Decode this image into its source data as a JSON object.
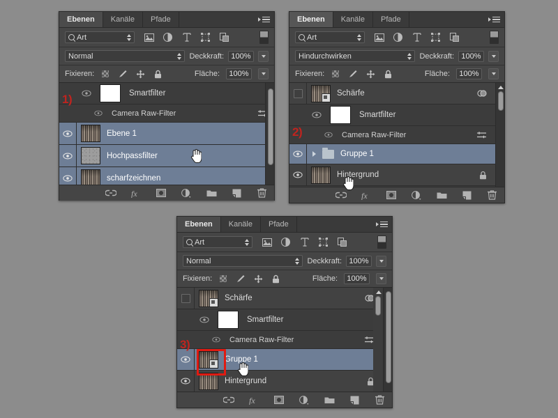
{
  "app": {
    "tabs": [
      "Ebenen",
      "Kanäle",
      "Pfade"
    ],
    "kind_filter_label": "Art",
    "opacity_label": "Deckkraft:",
    "fill_label": "Fläche:",
    "lock_label": "Fixieren:",
    "opacity_value": "100%",
    "fill_value": "100%",
    "filter_icons": [
      "pixel-layer-icon",
      "adjustment-layer-icon",
      "type-layer-icon",
      "shape-layer-icon",
      "smart-object-icon"
    ],
    "lock_icons": [
      "lock-transparency-icon",
      "lock-image-icon",
      "lock-position-icon",
      "lock-all-icon"
    ],
    "bottom_icons": [
      "link-layers-icon",
      "layer-style-fx-icon",
      "layer-mask-icon",
      "adjustment-layer-icon",
      "new-group-icon",
      "new-layer-icon",
      "delete-layer-icon"
    ]
  },
  "panel1": {
    "marker": "1)",
    "blend_mode": "Normal",
    "rows": [
      {
        "name": "Smartfilter",
        "type": "smartfilter-mask",
        "thumb": "white",
        "selected": false,
        "visible": true
      },
      {
        "name": "Camera Raw-Filter",
        "type": "smartfilter-entry",
        "selected": false,
        "visible": true
      },
      {
        "name": "Ebene 1",
        "type": "layer",
        "thumb": "photo",
        "selected": true,
        "visible": true
      },
      {
        "name": "Hochpassfilter",
        "type": "layer",
        "thumb": "gray",
        "selected": true,
        "visible": true
      },
      {
        "name": "scharfzeichnen",
        "type": "layer",
        "thumb": "photo",
        "selected": true,
        "visible": true
      }
    ]
  },
  "panel2": {
    "marker": "2)",
    "blend_mode": "Hindurchwirken",
    "rows": [
      {
        "name": "Schärfe",
        "type": "smart-object",
        "thumb": "photo",
        "selected": false,
        "visible": false
      },
      {
        "name": "Smartfilter",
        "type": "smartfilter-mask",
        "thumb": "white",
        "selected": false,
        "visible": true
      },
      {
        "name": "Camera Raw-Filter",
        "type": "smartfilter-entry",
        "selected": false,
        "visible": true
      },
      {
        "name": "Gruppe 1",
        "type": "group",
        "selected": true,
        "visible": true
      },
      {
        "name": "Hintergrund",
        "type": "background",
        "thumb": "photo",
        "selected": false,
        "visible": true,
        "locked": true
      }
    ]
  },
  "panel3": {
    "marker": "3)",
    "blend_mode": "Normal",
    "rows": [
      {
        "name": "Schärfe",
        "type": "smart-object",
        "thumb": "photo",
        "selected": false,
        "visible": false
      },
      {
        "name": "Smartfilter",
        "type": "smartfilter-mask",
        "thumb": "white",
        "selected": false,
        "visible": true
      },
      {
        "name": "Camera Raw-Filter",
        "type": "smartfilter-entry",
        "selected": false,
        "visible": true
      },
      {
        "name": "Gruppe 1",
        "type": "smart-object",
        "thumb": "photo",
        "selected": true,
        "visible": true,
        "highlighted": true
      },
      {
        "name": "Hintergrund",
        "type": "background",
        "thumb": "photo",
        "selected": false,
        "visible": true,
        "locked": true
      }
    ]
  },
  "colors": {
    "panel_bg": "#444444",
    "row_bg": "#424242",
    "selected_row": "#6e7e96",
    "annotation_red": "#c0241f",
    "highlight_red": "#e01b12",
    "canvas_bg": "#8c8c8c"
  }
}
